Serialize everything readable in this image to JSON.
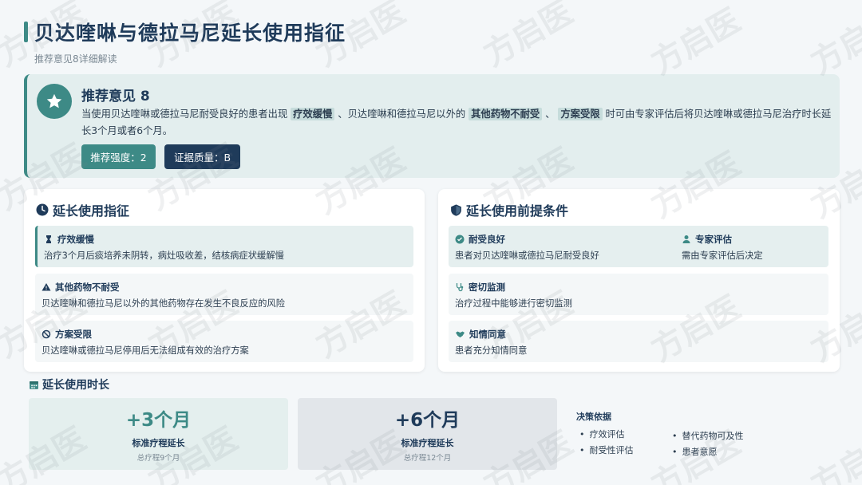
{
  "header": {
    "title": "贝达喹啉与德拉马尼延长使用指征",
    "subtitle": "推荐意见8详细解读"
  },
  "recommendation": {
    "title": "推荐意见 8",
    "text_1": "当使用贝达喹啉或德拉马尼耐受良好的患者出现",
    "hl_1": "疗效缓慢",
    "text_2": "、贝达喹啉和德拉马尼以外的",
    "hl_2": "其他药物不耐受",
    "text_3": "、",
    "hl_3": "方案受限",
    "text_4": "时可由专家评估后将贝达喹啉或德拉马尼治疗时长延长3个月或者6个月。",
    "strength": "推荐强度：2",
    "quality": "证据质量：B"
  },
  "indications": {
    "title": "延长使用指征",
    "items": [
      {
        "head": "疗效缓慢",
        "desc": "治疗3个月后痰培养未阴转，病灶吸收差，结核病症状缓解慢"
      },
      {
        "head": "其他药物不耐受",
        "desc": "贝达喹啉和德拉马尼以外的其他药物存在发生不良反应的风险"
      },
      {
        "head": "方案受限",
        "desc": "贝达喹啉或德拉马尼停用后无法组成有效的治疗方案"
      }
    ]
  },
  "prerequisites": {
    "title": "延长使用前提条件",
    "items": [
      {
        "head": "耐受良好",
        "desc": "患者对贝达喹啉或德拉马尼耐受良好"
      },
      {
        "head": "专家评估",
        "desc": "需由专家评估后决定"
      },
      {
        "head": "密切监测",
        "desc": "治疗过程中能够进行密切监测"
      },
      {
        "head": "知情同意",
        "desc": "患者充分知情同意"
      }
    ]
  },
  "duration": {
    "title": "延长使用时长",
    "options": [
      {
        "value": "+3个月",
        "label": "标准疗程延长",
        "sub": "总疗程9个月"
      },
      {
        "value": "+6个月",
        "label": "标准疗程延长",
        "sub": "总疗程12个月"
      }
    ],
    "basis_title": "决策依据",
    "basis": [
      "疗效评估",
      "耐受性评估",
      "替代药物可及性",
      "患者意愿"
    ]
  },
  "watermark": "方启医",
  "colors": {
    "accent": "#3d8a86",
    "navy": "#1f3b5a"
  }
}
